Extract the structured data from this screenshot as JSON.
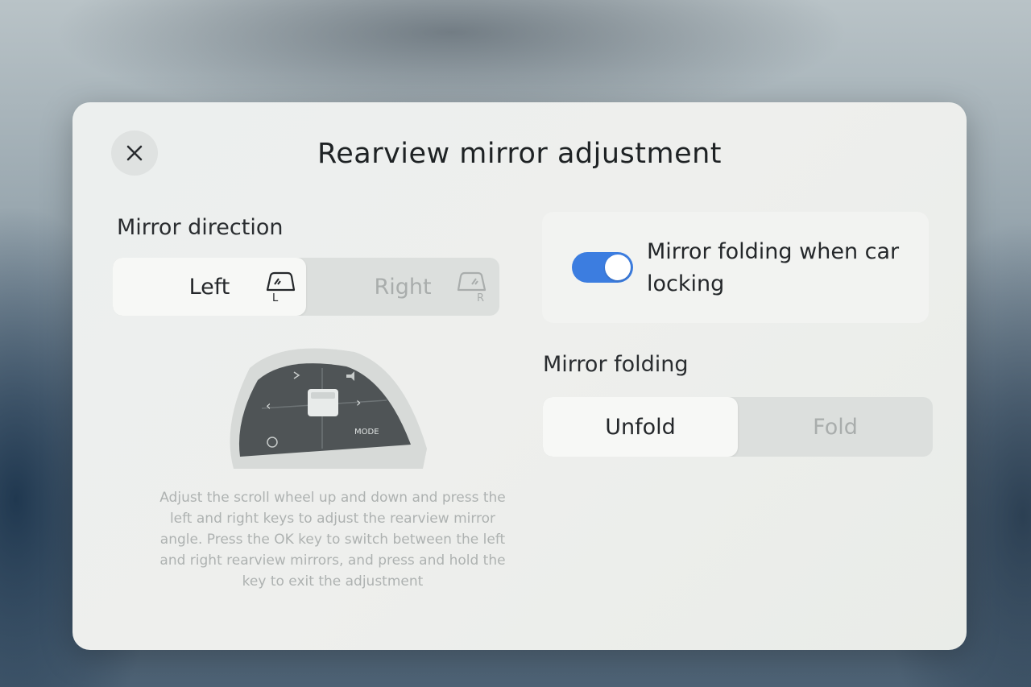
{
  "dialog": {
    "title": "Rearview mirror adjustment",
    "close_icon": "close-icon"
  },
  "mirror_direction": {
    "label": "Mirror direction",
    "options": [
      {
        "label": "Left",
        "badge": "L",
        "selected": true
      },
      {
        "label": "Right",
        "badge": "R",
        "selected": false
      }
    ]
  },
  "steering_wheel": {
    "mode_label": "MODE"
  },
  "help_text": "Adjust the scroll wheel up and down and press the left and right keys to adjust the rearview mirror angle. Press the OK key to switch between the left and right rearview mirrors, and press and hold the key to exit the adjustment",
  "folding_on_lock": {
    "label": "Mirror folding when car locking",
    "enabled": true
  },
  "mirror_folding": {
    "label": "Mirror folding",
    "options": [
      {
        "label": "Unfold",
        "selected": true
      },
      {
        "label": "Fold",
        "selected": false
      }
    ]
  },
  "colors": {
    "toggle_on": "#3c7de0",
    "panel_bg": "#eeefed"
  }
}
